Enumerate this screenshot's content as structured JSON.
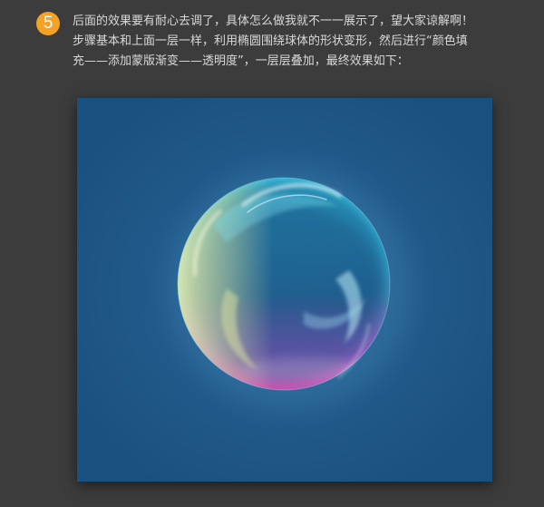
{
  "step": {
    "number": "5",
    "badge_color": "#f3a226",
    "text_lines": [
      "后面的效果要有耐心去调了，具体怎么做我就不一一展示了，望大家谅解啊！",
      "步骤基本和上面一层一样，利用椭圆围绕球体的形状变形，然后进行“颜色填",
      "充——添加蒙版渐变——透明度”，一层层叠加，最终效果如下："
    ]
  },
  "artwork": {
    "description_icon": "bubble-sphere-illustration",
    "background_color": "#1a5080",
    "bubble_colors": [
      "#27c6e6",
      "#e8eea0",
      "#c040b8",
      "#ffffff"
    ]
  }
}
